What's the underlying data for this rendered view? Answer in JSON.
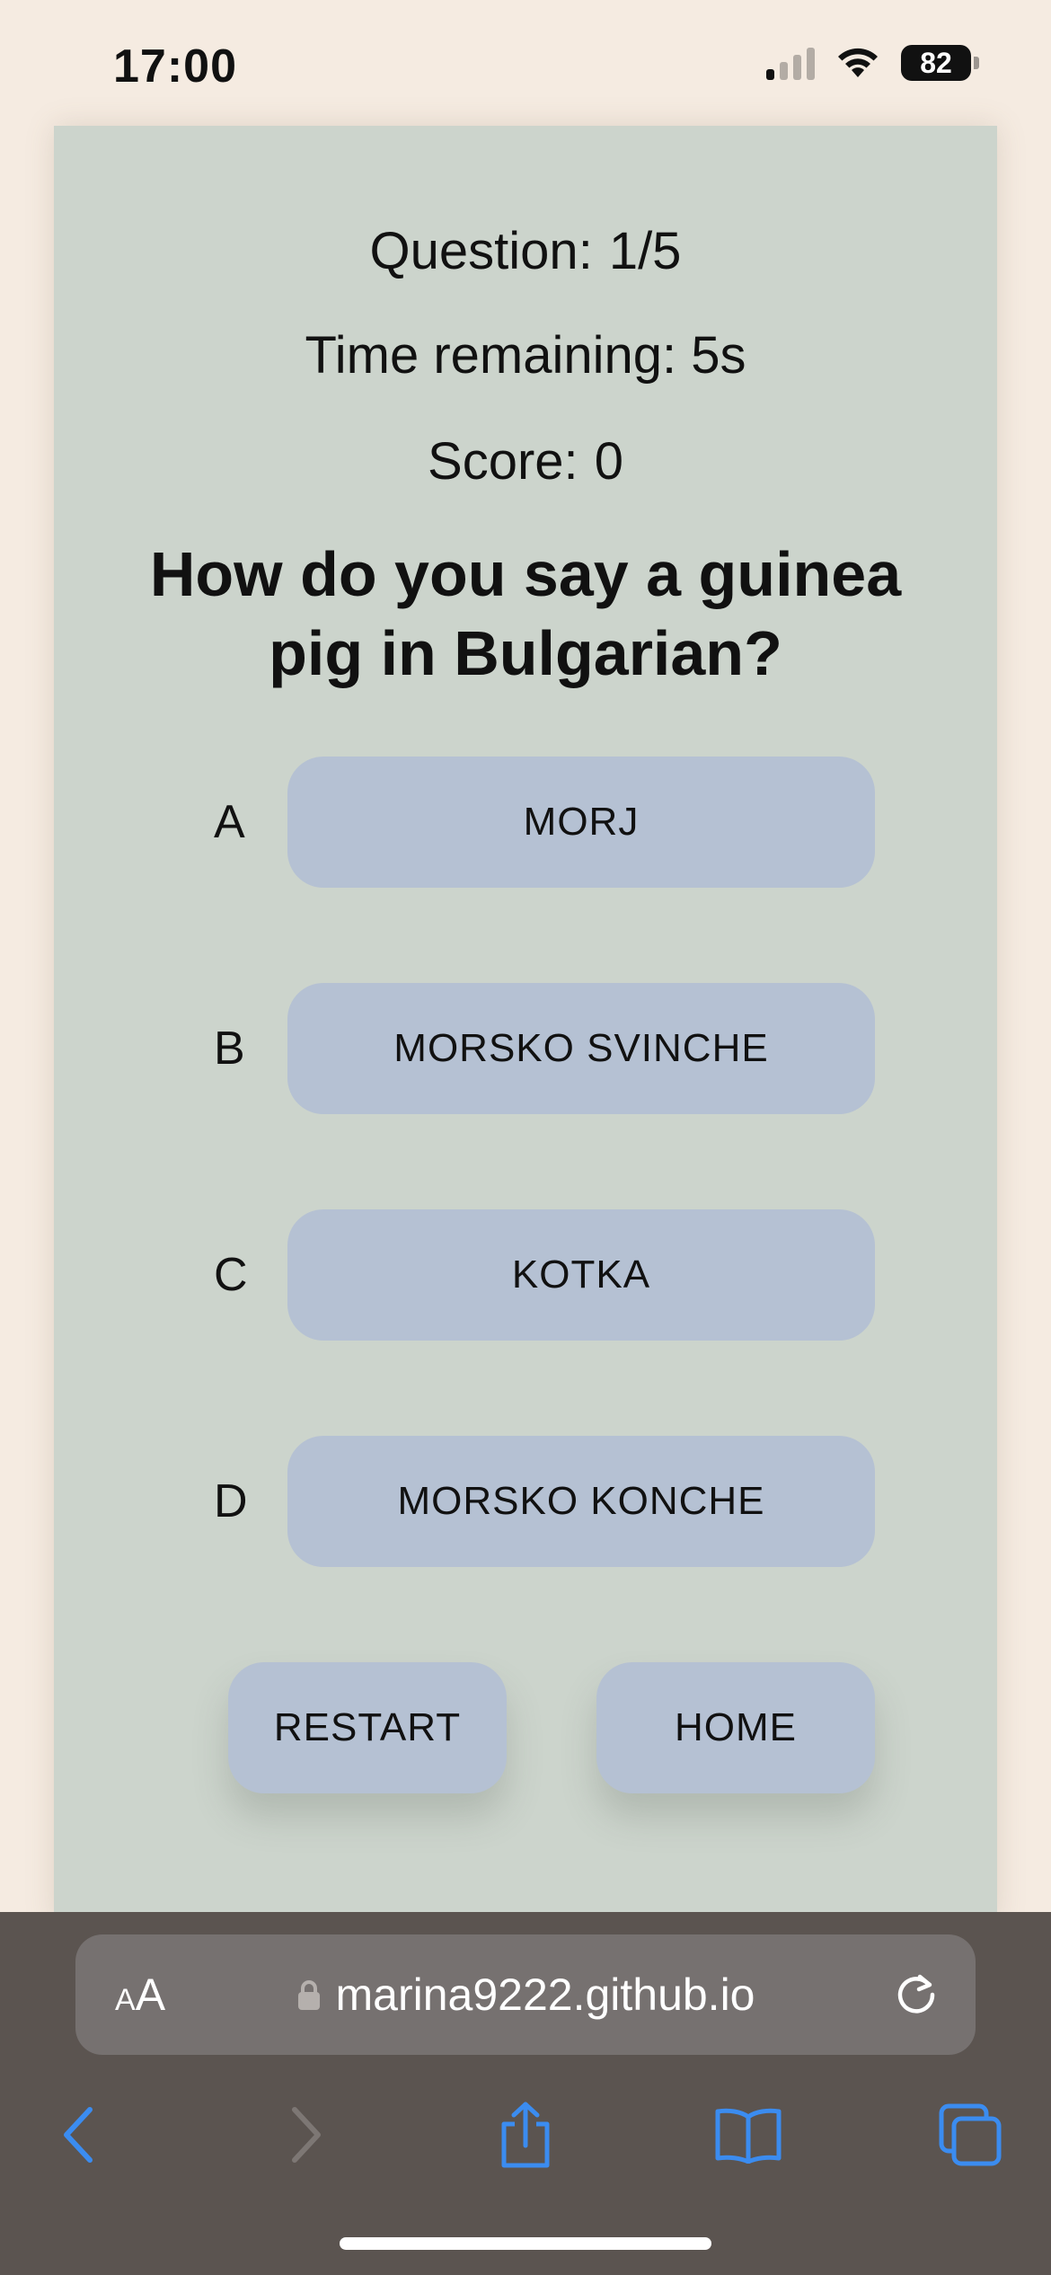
{
  "status_bar": {
    "time": "17:00",
    "battery": "82"
  },
  "quiz": {
    "question_label": "Question:",
    "question_value": "1/5",
    "time_text": "Time remaining: 5s",
    "score_label": "Score:",
    "score_value": "0",
    "question_text": "How do you say a guinea pig in Bulgarian?",
    "options": [
      {
        "letter": "A",
        "label": "MORJ"
      },
      {
        "letter": "B",
        "label": "MORSKO SVINCHE"
      },
      {
        "letter": "C",
        "label": "KOTKA"
      },
      {
        "letter": "D",
        "label": "MORSKO KONCHE"
      }
    ],
    "restart_label": "RESTART",
    "home_label": "HOME"
  },
  "browser": {
    "aa_small": "A",
    "aa_large": "A",
    "url": "marina9222.github.io"
  },
  "colors": {
    "page_bg": "#f5ebe1",
    "card_bg": "#ccd4cc",
    "button_bg": "#b5c1d3",
    "chrome_bg": "#5b5450",
    "toolbar_accent": "#3b8cf0"
  },
  "icons": [
    "signal-icon",
    "wifi-icon",
    "battery-icon",
    "lock-icon",
    "reload-icon",
    "back-icon",
    "forward-icon",
    "share-icon",
    "bookmarks-icon",
    "tabs-icon"
  ]
}
